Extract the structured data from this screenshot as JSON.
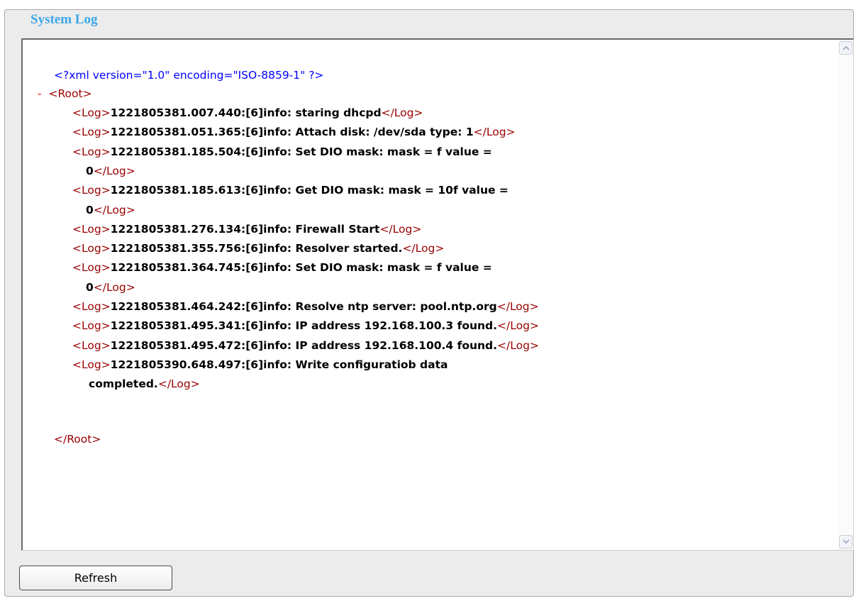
{
  "section": {
    "title": "System Log"
  },
  "log": {
    "xml_declaration": "<?xml version=\"1.0\" encoding=\"ISO-8859-1\" ?>",
    "collapse_marker": "-",
    "root_open": "<Root>",
    "root_close": "</Root>",
    "log_open": "<Log>",
    "log_close": "</Log>",
    "entries": [
      {
        "text": "1221805381.007.440:[6]info: staring dhcpd"
      },
      {
        "text": "1221805381.051.365:[6]info: Attach disk: /dev/sda type: 1"
      },
      {
        "text": "1221805381.185.504:[6]info: Set DIO mask: mask = f value =",
        "cont": "0"
      },
      {
        "text": "1221805381.185.613:[6]info: Get DIO mask: mask = 10f value =",
        "cont": "0"
      },
      {
        "text": "1221805381.276.134:[6]info: Firewall Start"
      },
      {
        "text": "1221805381.355.756:[6]info: Resolver started."
      },
      {
        "text": "1221805381.364.745:[6]info: Set DIO mask: mask = f value =",
        "cont": "0"
      },
      {
        "text": "1221805381.464.242:[6]info: Resolve ntp server: pool.ntp.org"
      },
      {
        "text": "1221805381.495.341:[6]info: IP address 192.168.100.3 found."
      },
      {
        "text": "1221805381.495.472:[6]info: IP address 192.168.100.4 found."
      },
      {
        "text": "1221805390.648.497:[6]info: Write configuratiob data",
        "cont": "completed."
      }
    ]
  },
  "icons": {
    "scroll_up": "chevron-up-icon",
    "scroll_down": "chevron-down-icon"
  },
  "buttons": {
    "refresh_label": "Refresh"
  },
  "colors": {
    "legend": "#3aa6e8",
    "xml_declaration": "#0000ff",
    "tag": "#990000",
    "collapse_marker": "#ff0000"
  }
}
